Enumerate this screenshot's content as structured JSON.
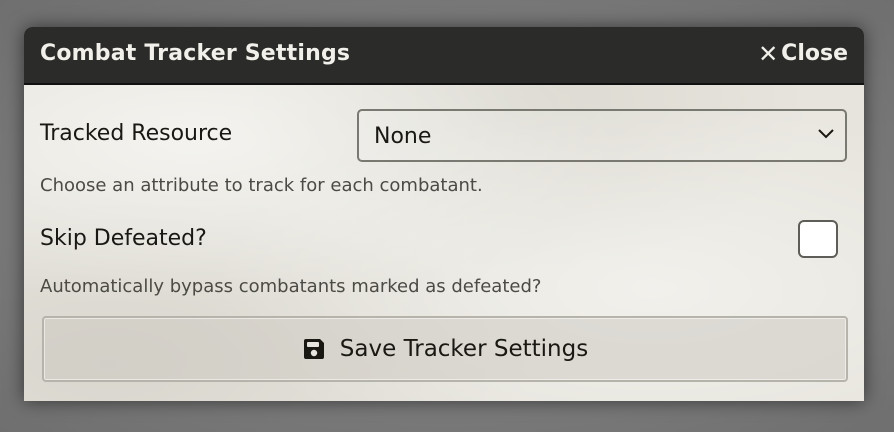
{
  "dialog": {
    "title": "Combat Tracker Settings",
    "close_label": "Close",
    "close_icon": "close-icon"
  },
  "tracked_resource": {
    "label": "Tracked Resource",
    "selected": "None",
    "hint": "Choose an attribute to track for each combatant."
  },
  "skip_defeated": {
    "label": "Skip Defeated?",
    "checked": false,
    "hint": "Automatically bypass combatants marked as defeated?"
  },
  "save_button": {
    "label": "Save Tracker Settings",
    "icon": "floppy-disk-icon"
  },
  "colors": {
    "titlebar": "#2b2b29",
    "title_text": "#f2f0ea",
    "body_text": "#191813",
    "hint_text": "#4b4a44"
  }
}
